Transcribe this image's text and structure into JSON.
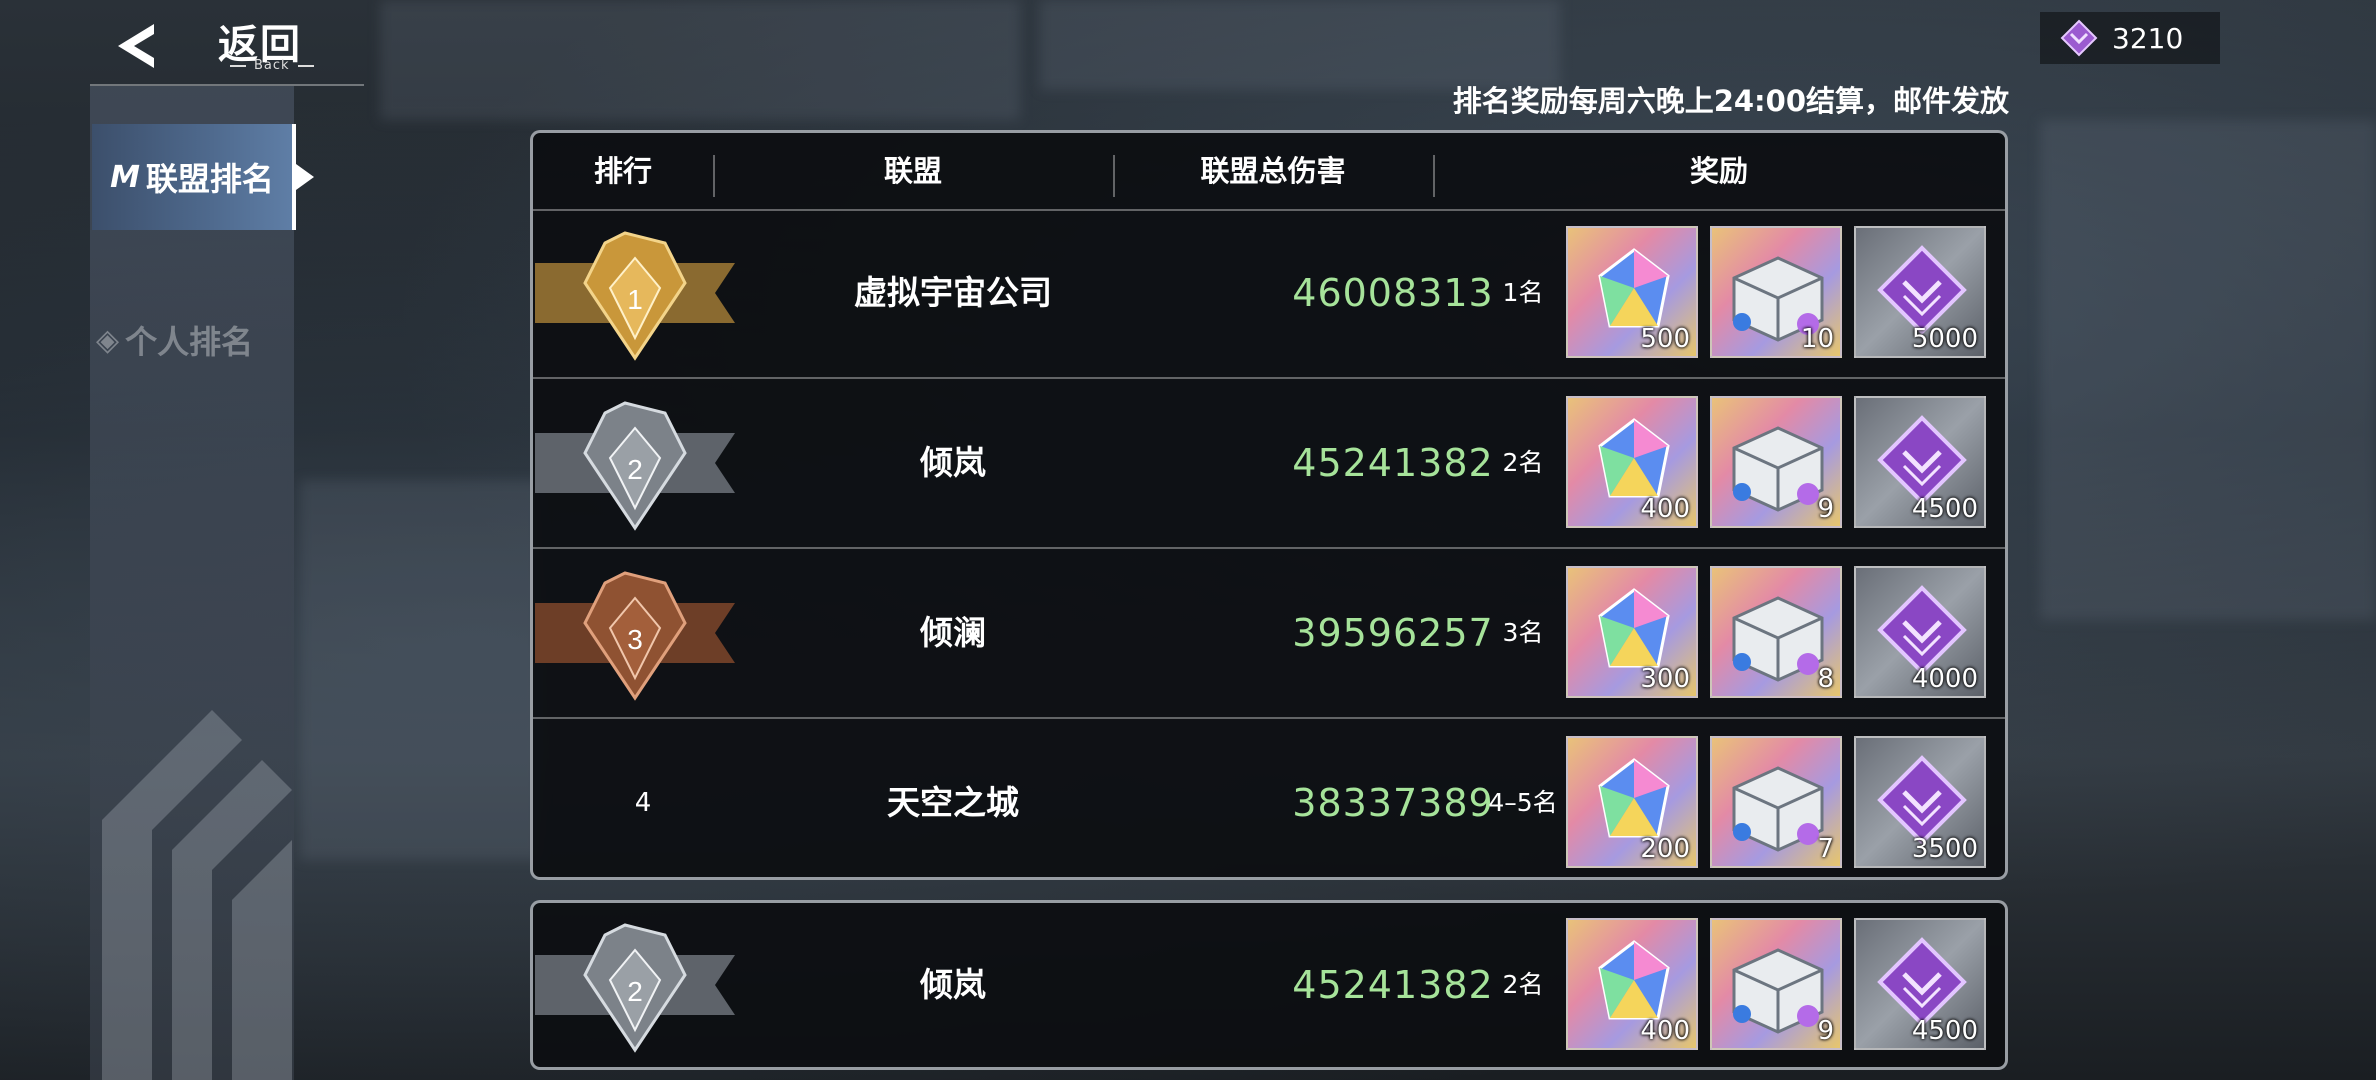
{
  "header": {
    "back_label": "返回",
    "back_sub": "Back"
  },
  "sidebar": {
    "tabs": [
      {
        "label": "联盟排名",
        "active": true
      },
      {
        "label": "个人排名",
        "active": false
      }
    ]
  },
  "currency": {
    "icon": "purple-crystal-icon",
    "value": "3210"
  },
  "notice": "排名奖励每周六晚上24:00结算，邮件发放",
  "table": {
    "columns": [
      "排行",
      "联盟",
      "联盟总伤害",
      "奖励"
    ],
    "rows": [
      {
        "rank": "1",
        "badge": "gold-rank-badge",
        "alliance": "虚拟宇宙公司",
        "damage": "46008313",
        "place": "1名",
        "rewards": [
          {
            "icon": "rainbow-gem-icon",
            "qty": "500"
          },
          {
            "icon": "supply-box-icon",
            "qty": "10"
          },
          {
            "icon": "purple-crystal-icon",
            "qty": "5000"
          }
        ]
      },
      {
        "rank": "2",
        "badge": "silver-rank-badge",
        "alliance": "倾岚",
        "damage": "45241382",
        "place": "2名",
        "rewards": [
          {
            "icon": "rainbow-gem-icon",
            "qty": "400"
          },
          {
            "icon": "supply-box-icon",
            "qty": "9"
          },
          {
            "icon": "purple-crystal-icon",
            "qty": "4500"
          }
        ]
      },
      {
        "rank": "3",
        "badge": "bronze-rank-badge",
        "alliance": "倾澜",
        "damage": "39596257",
        "place": "3名",
        "rewards": [
          {
            "icon": "rainbow-gem-icon",
            "qty": "300"
          },
          {
            "icon": "supply-box-icon",
            "qty": "8"
          },
          {
            "icon": "purple-crystal-icon",
            "qty": "4000"
          }
        ]
      },
      {
        "rank": "4",
        "badge": "",
        "alliance": "天空之城",
        "damage": "38337389",
        "place": "4–5名",
        "rewards": [
          {
            "icon": "rainbow-gem-icon",
            "qty": "200"
          },
          {
            "icon": "supply-box-icon",
            "qty": "7"
          },
          {
            "icon": "purple-crystal-icon",
            "qty": "3500"
          }
        ]
      }
    ]
  },
  "my_rank": {
    "rank": "2",
    "badge": "silver-rank-badge",
    "alliance": "倾岚",
    "damage": "45241382",
    "place": "2名",
    "rewards": [
      {
        "icon": "rainbow-gem-icon",
        "qty": "400"
      },
      {
        "icon": "supply-box-icon",
        "qty": "9"
      },
      {
        "icon": "purple-crystal-icon",
        "qty": "4500"
      }
    ]
  },
  "colors": {
    "damage_text": "#a6e39a",
    "gold": "#c9973a",
    "silver": "#9a9fa6",
    "bronze": "#a35f3b",
    "accent_purple": "#9b5bd0"
  }
}
